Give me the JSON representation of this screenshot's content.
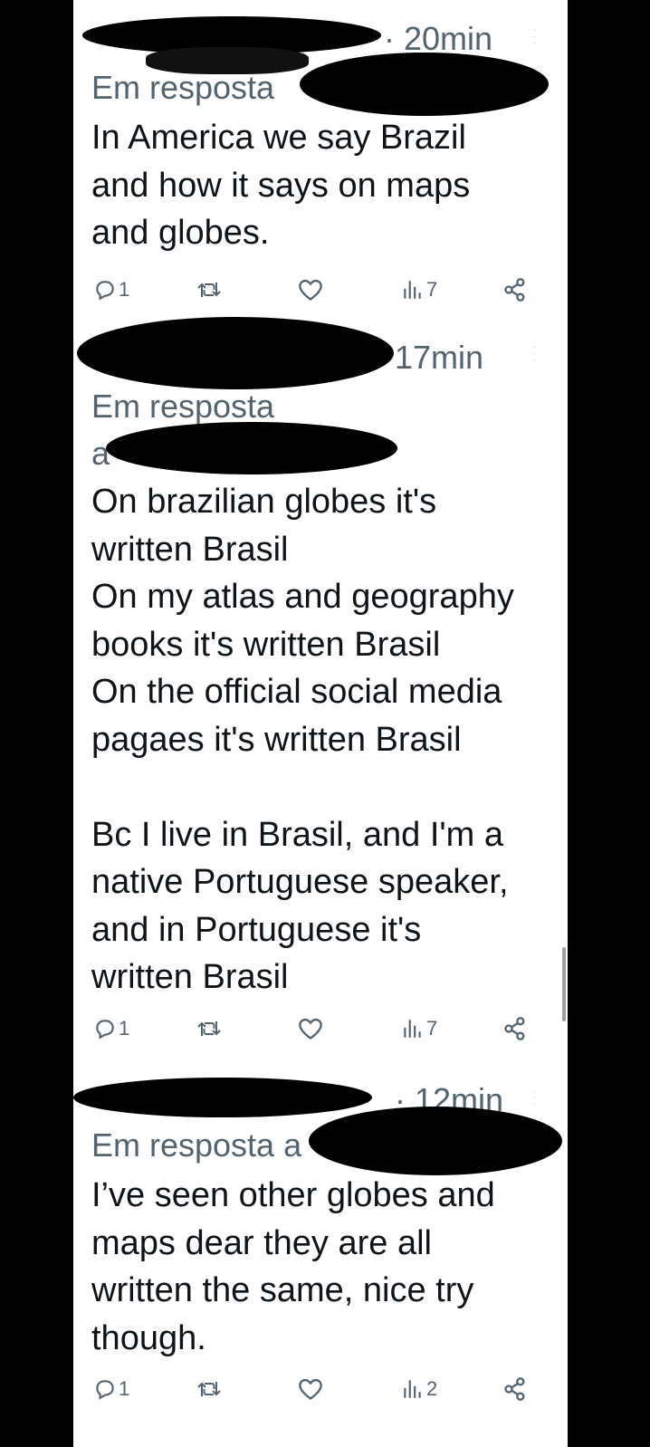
{
  "scrollbar": {
    "color": "#9aa0a6"
  },
  "icons": {
    "reply": "reply-icon",
    "retweet": "retweet-icon",
    "like": "heart-icon",
    "views": "views-icon",
    "share": "share-icon",
    "more": "more-icon"
  },
  "tweets": [
    {
      "timestamp": "· 20min",
      "reply_prefix": "Em resposta",
      "text": "In America we say Brazil\nand how it says on maps\nand globes.",
      "reply_count": "1",
      "view_count": "7"
    },
    {
      "timestamp": "17min",
      "reply_prefix": "Em resposta",
      "reply_prefix_2": "a",
      "text": "On brazilian globes it's\nwritten Brasil\nOn my atlas and geography\nbooks it's written Brasil\nOn the official social media\npagaes it's written Brasil\n\nBc I live in Brasil, and I'm a\nnative Portuguese speaker,\nand in Portuguese it's\nwritten Brasil",
      "reply_count": "1",
      "view_count": "7"
    },
    {
      "timestamp": "· 12min",
      "reply_prefix": "Em resposta a",
      "text": "I’ve seen other globes and\nmaps dear they are all\nwritten the same, nice try\nthough.",
      "reply_count": "1",
      "view_count": "2"
    }
  ]
}
